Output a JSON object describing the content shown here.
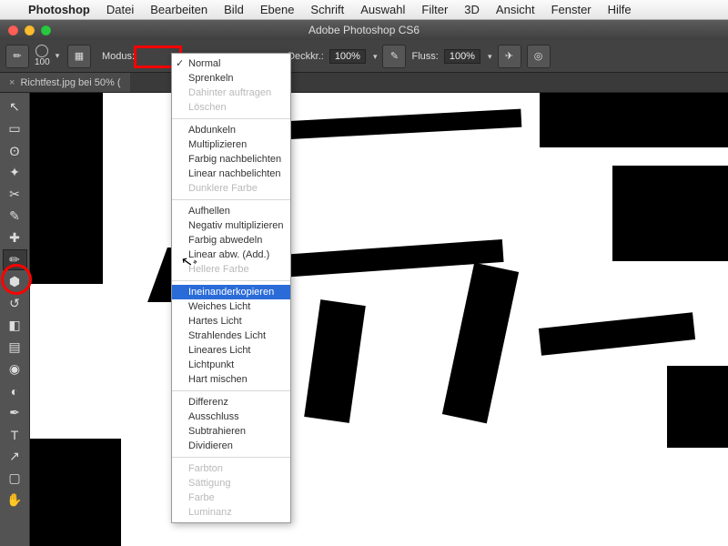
{
  "menus": {
    "apple": "",
    "app": "Photoshop",
    "items": [
      "Datei",
      "Bearbeiten",
      "Bild",
      "Ebene",
      "Schrift",
      "Auswahl",
      "Filter",
      "3D",
      "Ansicht",
      "Fenster",
      "Hilfe"
    ]
  },
  "window_title": "Adobe Photoshop CS6",
  "opt": {
    "brush_size": "100",
    "modus_label": "Modus:",
    "deckk_label": "Deckkr.:",
    "deckk_val": "100%",
    "fluss_label": "Fluss:",
    "fluss_val": "100%"
  },
  "doc_tab": "Richtfest.jpg bei 50% (",
  "tools": [
    "move",
    "marquee",
    "lasso",
    "wand",
    "crop",
    "eyedropper",
    "heal",
    "brush",
    "stamp",
    "history",
    "eraser",
    "gradient",
    "blur",
    "dodge",
    "pen",
    "type",
    "path",
    "shape",
    "hand"
  ],
  "tool_icons": {
    "move": "↖",
    "marquee": "▭",
    "lasso": "ʘ",
    "wand": "✦",
    "crop": "✂",
    "eyedropper": "✎",
    "heal": "✚",
    "brush": "✏",
    "stamp": "⬢",
    "history": "↺",
    "eraser": "◧",
    "gradient": "▤",
    "blur": "◉",
    "dodge": "◐",
    "pen": "✒",
    "type": "T",
    "path": "↗",
    "shape": "▢",
    "hand": "✋"
  },
  "highlighted_tool": "brush",
  "modus_menu": {
    "groups": [
      [
        {
          "t": "Normal",
          "checked": true
        },
        {
          "t": "Sprenkeln"
        },
        {
          "t": "Dahinter auftragen",
          "disabled": true
        },
        {
          "t": "Löschen",
          "disabled": true
        }
      ],
      [
        {
          "t": "Abdunkeln"
        },
        {
          "t": "Multiplizieren"
        },
        {
          "t": "Farbig nachbelichten"
        },
        {
          "t": "Linear nachbelichten"
        },
        {
          "t": "Dunklere Farbe",
          "disabled": true
        }
      ],
      [
        {
          "t": "Aufhellen"
        },
        {
          "t": "Negativ multiplizieren"
        },
        {
          "t": "Farbig abwedeln"
        },
        {
          "t": "Linear abw. (Add.)"
        },
        {
          "t": "Hellere Farbe",
          "disabled": true
        }
      ],
      [
        {
          "t": "Ineinanderkopieren",
          "hl": true
        },
        {
          "t": "Weiches Licht"
        },
        {
          "t": "Hartes Licht"
        },
        {
          "t": "Strahlendes Licht"
        },
        {
          "t": "Lineares Licht"
        },
        {
          "t": "Lichtpunkt"
        },
        {
          "t": "Hart mischen"
        }
      ],
      [
        {
          "t": "Differenz"
        },
        {
          "t": "Ausschluss"
        },
        {
          "t": "Subtrahieren"
        },
        {
          "t": "Dividieren"
        }
      ],
      [
        {
          "t": "Farbton",
          "disabled": true
        },
        {
          "t": "Sättigung",
          "disabled": true
        },
        {
          "t": "Farbe",
          "disabled": true
        },
        {
          "t": "Luminanz",
          "disabled": true
        }
      ]
    ]
  }
}
